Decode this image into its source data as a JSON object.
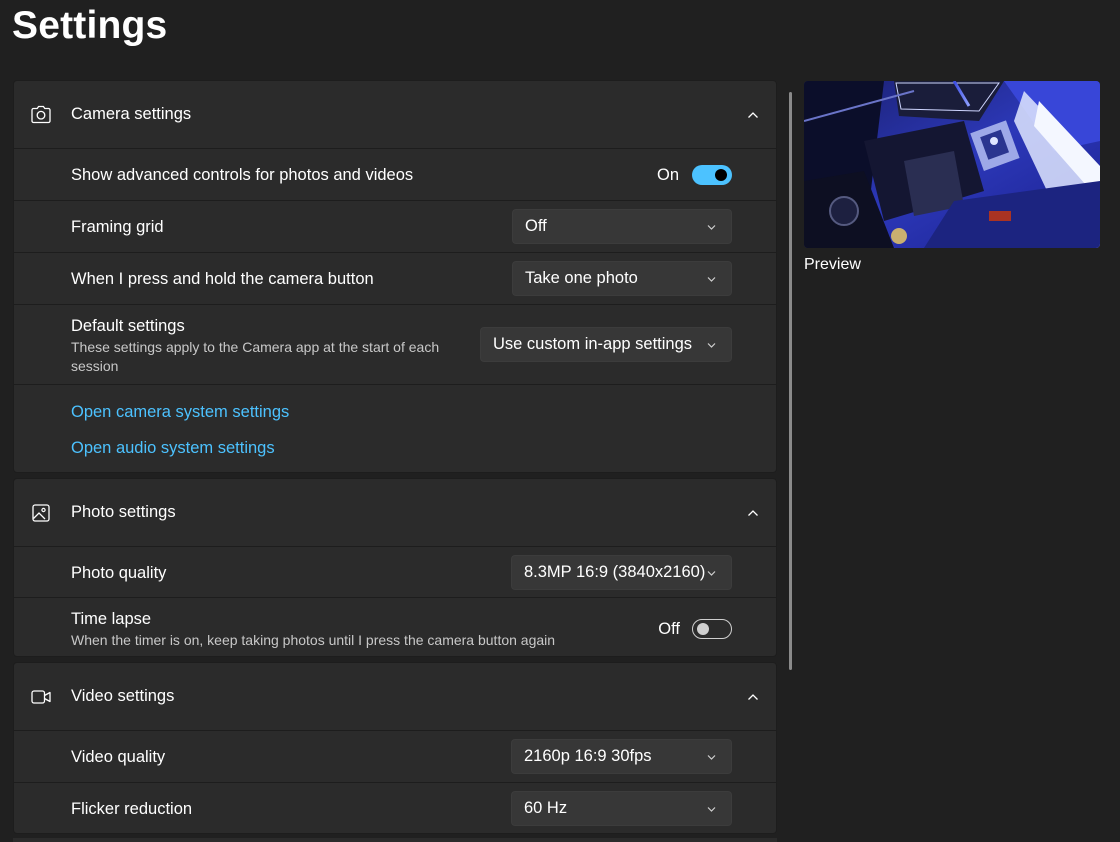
{
  "page": {
    "title": "Settings"
  },
  "camera": {
    "title": "Camera settings",
    "icon": "camera-icon",
    "advanced": {
      "label": "Show advanced controls for photos and videos",
      "state": "On"
    },
    "framing_grid": {
      "label": "Framing grid",
      "value": "Off"
    },
    "press_hold": {
      "label": "When I press and hold the camera button",
      "value": "Take one photo"
    },
    "defaults": {
      "label": "Default settings",
      "sub": "These settings apply to the Camera app at the start of each session",
      "value": "Use custom in-app settings"
    },
    "links": {
      "camera_system": "Open camera system settings",
      "audio_system": "Open audio system settings"
    }
  },
  "photo": {
    "title": "Photo settings",
    "icon": "image-icon",
    "quality": {
      "label": "Photo quality",
      "value": "8.3MP 16:9 (3840x2160)"
    },
    "time_lapse": {
      "label": "Time lapse",
      "sub": "When the timer is on, keep taking photos until I press the camera button again",
      "state": "Off"
    }
  },
  "video": {
    "title": "Video settings",
    "icon": "video-camera-icon",
    "quality": {
      "label": "Video quality",
      "value": "2160p 16:9 30fps"
    },
    "flicker": {
      "label": "Flicker reduction",
      "value": "60 Hz"
    }
  },
  "preview": {
    "label": "Preview"
  },
  "colors": {
    "background": "#202020",
    "panel": "#2b2b2b",
    "accent": "#4cc2ff",
    "dropdown": "#373737"
  }
}
